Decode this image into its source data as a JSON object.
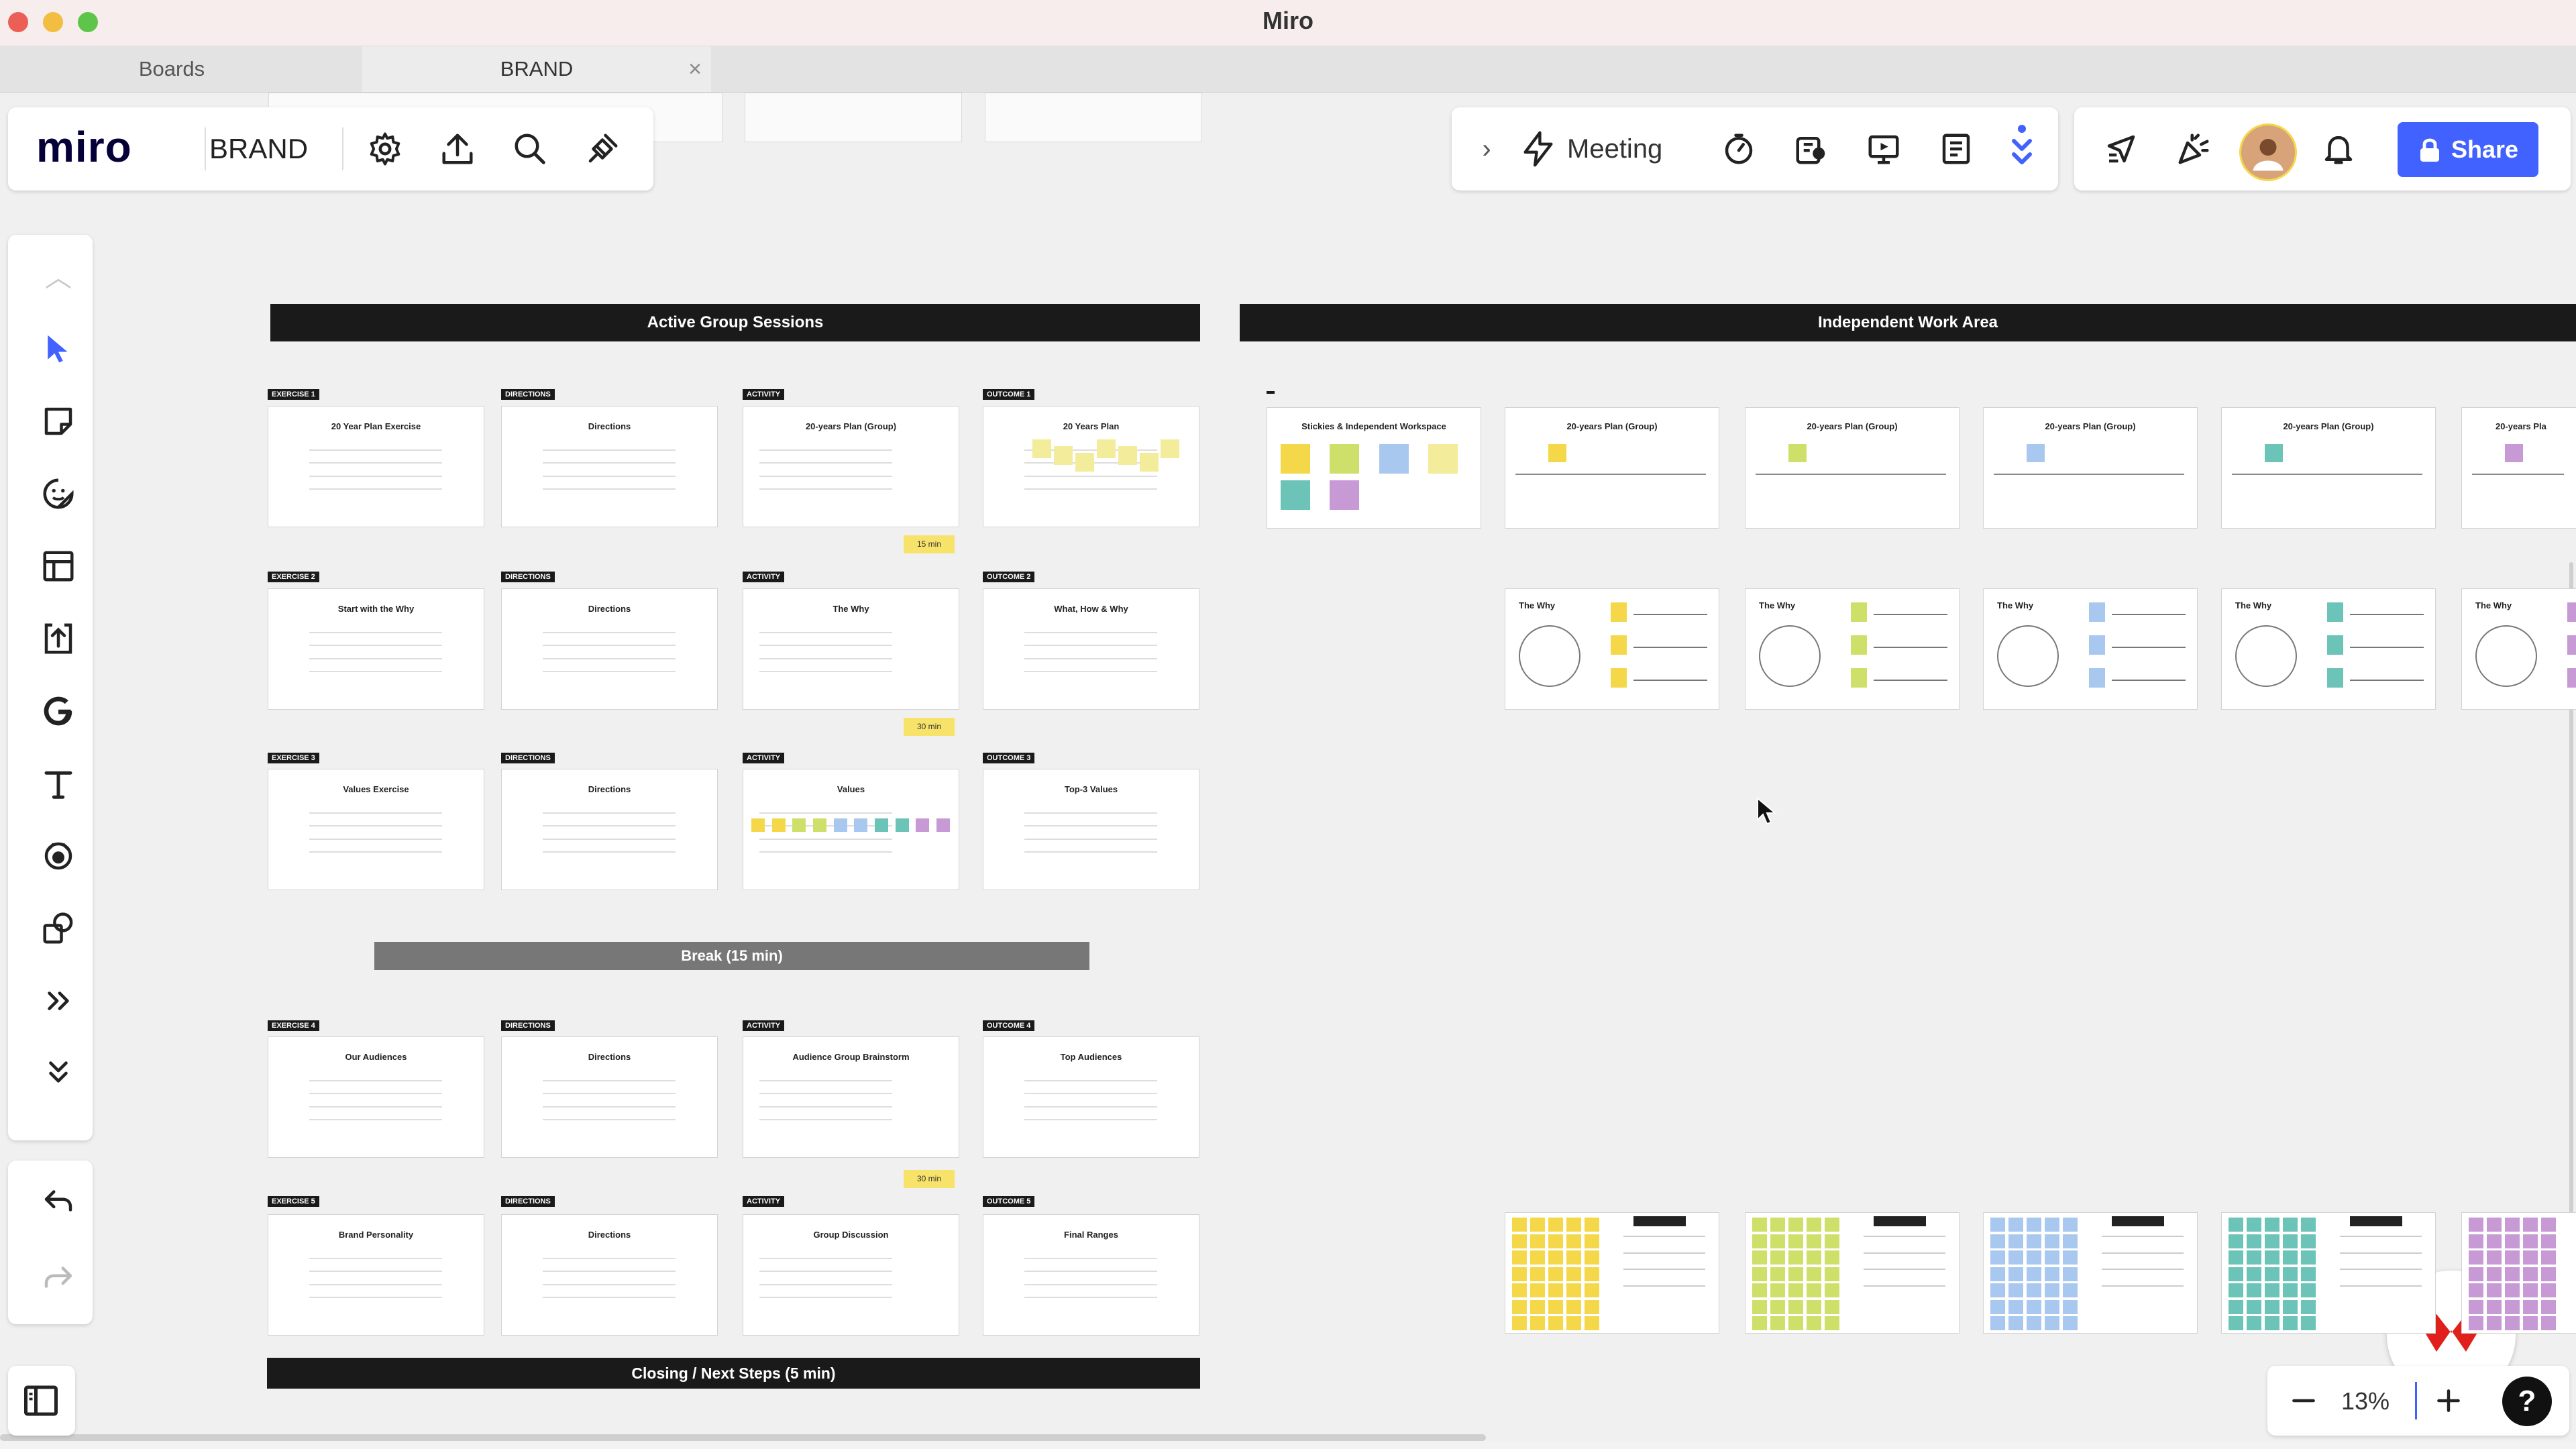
{
  "window": {
    "title": "Miro"
  },
  "tabs": [
    {
      "label": "Boards"
    },
    {
      "label": "BRAND"
    }
  ],
  "board": {
    "logo": "miro",
    "name": "BRAND"
  },
  "toolbar_right": {
    "meeting_label": "Meeting",
    "share_label": "Share"
  },
  "zoom": {
    "level": "13%",
    "help": "?"
  },
  "sections": {
    "active_group": "Active Group Sessions",
    "independent": "Independent Work Area",
    "break": "Break (15 min)",
    "closing": "Closing / Next Steps (5 min)"
  },
  "active_rows": [
    {
      "cards": [
        {
          "tag": "EXERCISE 1",
          "title": "20 Year Plan Exercise"
        },
        {
          "tag": "DIRECTIONS",
          "title": "Directions"
        },
        {
          "tag": "ACTIVITY",
          "title": "20-years Plan (Group)"
        },
        {
          "tag": "OUTCOME 1",
          "title": "20 Years Plan"
        }
      ],
      "time": "15 min"
    },
    {
      "cards": [
        {
          "tag": "EXERCISE 2",
          "title": "Start with the Why"
        },
        {
          "tag": "DIRECTIONS",
          "title": "Directions"
        },
        {
          "tag": "ACTIVITY",
          "title": "The Why"
        },
        {
          "tag": "OUTCOME 2",
          "title": "What, How & Why"
        }
      ],
      "time": "30 min"
    },
    {
      "cards": [
        {
          "tag": "EXERCISE 3",
          "title": "Values Exercise"
        },
        {
          "tag": "DIRECTIONS",
          "title": "Directions"
        },
        {
          "tag": "ACTIVITY",
          "title": "Values"
        },
        {
          "tag": "OUTCOME 3",
          "title": "Top-3 Values"
        }
      ],
      "time": ""
    },
    {
      "cards": [
        {
          "tag": "EXERCISE 4",
          "title": "Our Audiences"
        },
        {
          "tag": "DIRECTIONS",
          "title": "Directions"
        },
        {
          "tag": "ACTIVITY",
          "title": "Audience Group Brainstorm"
        },
        {
          "tag": "OUTCOME 4",
          "title": "Top Audiences"
        }
      ],
      "time": "30 min"
    },
    {
      "cards": [
        {
          "tag": "EXERCISE 5",
          "title": "Brand Personality"
        },
        {
          "tag": "DIRECTIONS",
          "title": "Directions"
        },
        {
          "tag": "ACTIVITY",
          "title": "Group Discussion"
        },
        {
          "tag": "OUTCOME 5",
          "title": "Final Ranges"
        }
      ],
      "time": ""
    }
  ],
  "independent_row1": {
    "first_title": "Stickies & Independent Workspace",
    "group_title": "20-years Plan (Group)",
    "partial_title": "20-years Pla"
  },
  "independent_row2_title": "The Why",
  "colors": {
    "yellow": "#f5d84a",
    "lime": "#cfe06a",
    "blue": "#a9c8ef",
    "teal": "#6cc4b8",
    "purple": "#c79ad6",
    "share_blue": "#4262ff",
    "accent_red": "#e0201b"
  }
}
